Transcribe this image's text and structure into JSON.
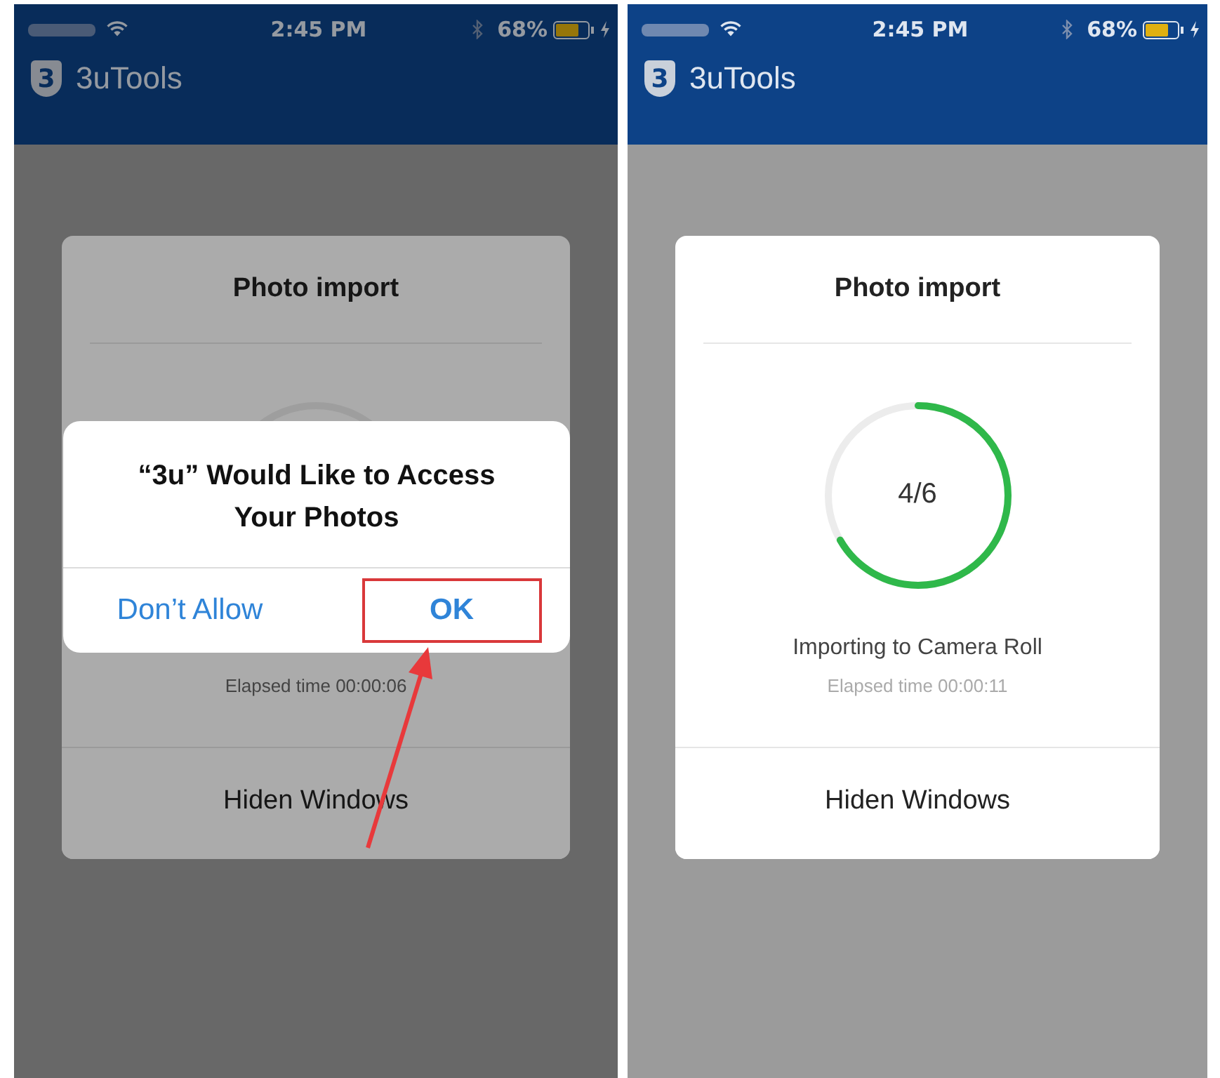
{
  "phones": [
    {
      "dimmed": true,
      "status_bar": {
        "time": "2:45 PM",
        "battery": "68%"
      },
      "app_bar": {
        "logo": "3",
        "title": "3uTools"
      },
      "dialog": {
        "title": "Photo import",
        "elapsed": "Elapsed time 00:00:06",
        "button": "Hiden Windows"
      },
      "alert": {
        "title": "“3u” Would Like to Access Your Photos",
        "buttons": [
          {
            "label": "Don’t Allow",
            "highlighted": false
          },
          {
            "label": "OK",
            "highlighted": true
          }
        ]
      }
    },
    {
      "dimmed": false,
      "status_bar": {
        "time": "2:45 PM",
        "battery": "68%"
      },
      "app_bar": {
        "logo": "3",
        "title": "3uTools"
      },
      "dialog": {
        "title": "Photo import",
        "progress": {
          "level": 0.667,
          "reading": "4/6"
        },
        "status": "Importing to Camera Roll",
        "elapsed": "Elapsed time 00:00:11",
        "button": "Hiden Windows"
      }
    }
  ]
}
